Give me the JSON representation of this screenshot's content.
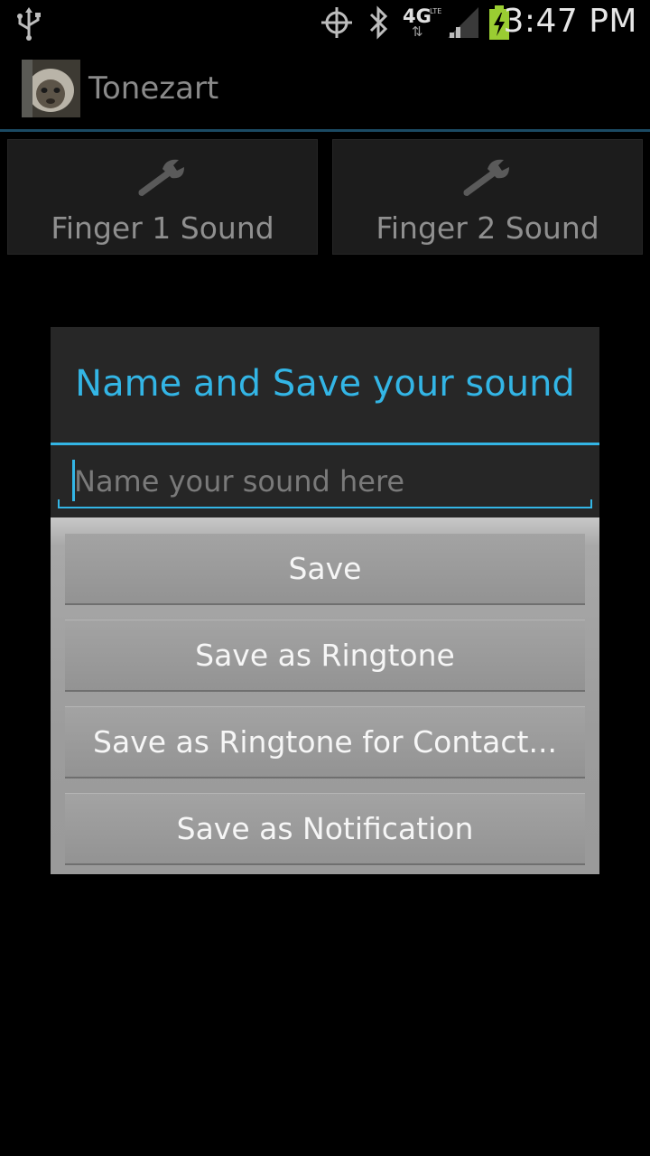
{
  "status_bar": {
    "time": "3:47 PM",
    "network_label": "4G",
    "network_sub": "LTE",
    "icons": [
      "usb-icon",
      "gps-icon",
      "bluetooth-icon",
      "network-4g-icon",
      "signal-icon",
      "battery-charging-icon"
    ]
  },
  "app": {
    "title": "Tonezart"
  },
  "finger_buttons": [
    {
      "label": "Finger 1 Sound",
      "icon": "wrench-icon"
    },
    {
      "label": "Finger 2 Sound",
      "icon": "wrench-icon"
    }
  ],
  "dialog": {
    "title": "Name and Save your sound",
    "input": {
      "value": "",
      "placeholder": "Name your sound here"
    },
    "buttons": [
      {
        "label": "Save"
      },
      {
        "label": "Save as Ringtone"
      },
      {
        "label": "Save as Ringtone for Contact..."
      },
      {
        "label": "Save as Notification"
      }
    ]
  },
  "colors": {
    "accent": "#33b5e5",
    "background": "#000000",
    "dialog_bg": "#262626"
  }
}
